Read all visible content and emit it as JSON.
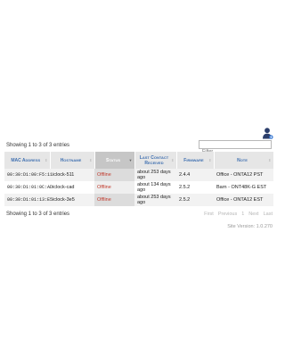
{
  "table": {
    "info_text": "Showing 1 to 3 of 3 entries",
    "filter_placeholder": "Filter",
    "columns": [
      "MAC Address",
      "Hostname",
      "Status",
      "Last Contact Received",
      "Firmware",
      "Note"
    ],
    "rows": [
      {
        "mac": "00:30:D1:00:F5:11",
        "hostname": "iclock-511",
        "status": "Offline",
        "last_contact": "about 253 days ago",
        "firmware": "2.4.4",
        "note": "Office - ONTA12 PST"
      },
      {
        "mac": "00:30:D1:01:0C:AD",
        "hostname": "iclock-cad",
        "status": "Offline",
        "last_contact": "about 134 days ago",
        "firmware": "2.5.2",
        "note": "Barn - ONT48K-G EST"
      },
      {
        "mac": "00:30:D1:01:13:E5",
        "hostname": "iclock-3e5",
        "status": "Offline",
        "last_contact": "about 253 days ago",
        "firmware": "2.5.2",
        "note": "Office - ONTA12 EST"
      }
    ]
  },
  "pagination": {
    "first": "First",
    "previous": "Previous",
    "page": "1",
    "next": "Next",
    "last": "Last"
  },
  "footer": {
    "version": "Site Version: 1.0.270"
  },
  "colors": {
    "header_text": "#3e6fb0",
    "status_offline": "#c0392b",
    "user_icon": "#2c3e6b"
  }
}
